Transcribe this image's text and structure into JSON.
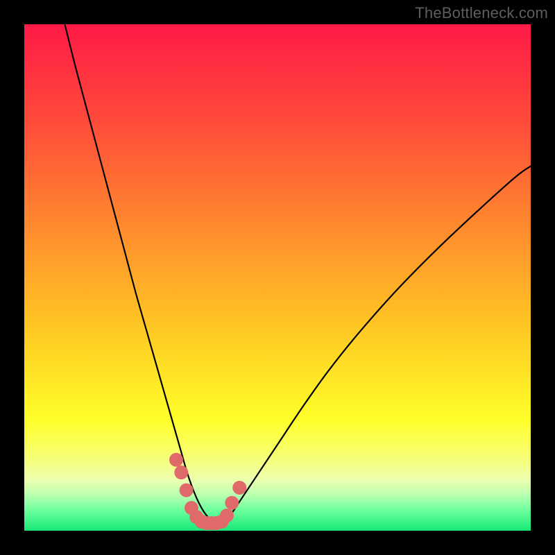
{
  "watermark": "TheBottleneck.com",
  "chart_data": {
    "type": "line",
    "title": "",
    "xlabel": "",
    "ylabel": "",
    "xlim": [
      0,
      100
    ],
    "ylim": [
      0,
      100
    ],
    "grid": false,
    "legend": false,
    "background_gradient_stops": [
      {
        "offset": 0.0,
        "color": "#ff1a47"
      },
      {
        "offset": 0.2,
        "color": "#ff4d3a"
      },
      {
        "offset": 0.4,
        "color": "#ff8a2e"
      },
      {
        "offset": 0.6,
        "color": "#ffc823"
      },
      {
        "offset": 0.78,
        "color": "#ffff2a"
      },
      {
        "offset": 0.86,
        "color": "#f6ff7a"
      },
      {
        "offset": 0.9,
        "color": "#ecffb0"
      },
      {
        "offset": 0.93,
        "color": "#b8ffb0"
      },
      {
        "offset": 0.96,
        "color": "#6bff9c"
      },
      {
        "offset": 1.0,
        "color": "#17e876"
      }
    ],
    "series": [
      {
        "name": "bottleneck-curve",
        "stroke": "#000000",
        "stroke_width": 2.2,
        "x": [
          8,
          10,
          12,
          14,
          16,
          18,
          20,
          22,
          24,
          26,
          28,
          30,
          31,
          32,
          33,
          34,
          35,
          36,
          37,
          38,
          39,
          40,
          41,
          43,
          46,
          50,
          55,
          60,
          66,
          74,
          84,
          96,
          100
        ],
        "values": [
          100,
          92,
          84.5,
          77,
          69.5,
          62,
          54.5,
          47,
          40,
          33,
          26,
          19,
          15.5,
          12,
          9,
          6.5,
          4.5,
          3.0,
          2.0,
          1.4,
          1.5,
          2.2,
          3.5,
          6.5,
          11,
          17,
          24.5,
          31.5,
          39,
          48,
          58,
          69,
          72
        ]
      }
    ],
    "marker_series": {
      "name": "highlight-points",
      "color": "#e06a6a",
      "radius": 10,
      "x": [
        30.0,
        31.0,
        32.0,
        33.0,
        34.0,
        35.0,
        36.0,
        37.0,
        38.0,
        39.0,
        40.0,
        41.0,
        42.5
      ],
      "values": [
        14.0,
        11.5,
        8.0,
        4.5,
        2.7,
        1.8,
        1.5,
        1.5,
        1.5,
        1.8,
        3.0,
        5.5,
        8.5
      ]
    }
  }
}
